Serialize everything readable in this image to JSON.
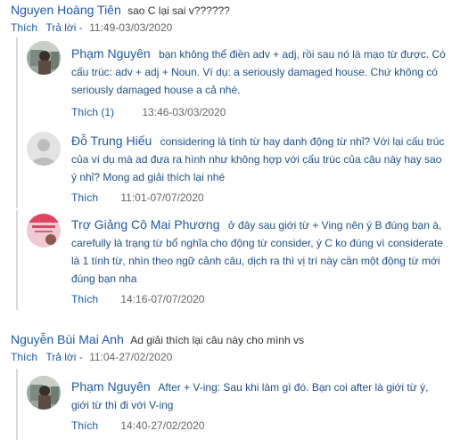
{
  "comments": [
    {
      "author": "Nguyen Hoàng Tiên",
      "text": "sao C lại sai v??????",
      "like": "Thích",
      "reply": "Trả lời -",
      "time": "11:49-03/03/2020",
      "replies": [
        {
          "author": "Phạm Nguyên",
          "text": "bạn không thể điền adv + adj, rồi sau nó là mạo từ được. Có cấu trúc: adv + adj + Noun. Ví dụ: a seriously damaged house. Chứ không có seriously damaged house a cả nhé.",
          "like": "Thích (1)",
          "time": "13:46-03/03/2020"
        },
        {
          "author": "Đỗ Trung Hiếu",
          "text": "considering là tính từ hay danh động từ nhỉ? Với lại cấu trúc của ví dụ mà ad đưa ra hình như không hợp với cấu trúc của câu này hay sao ý nhỉ? Mong ad giải thích lại nhé",
          "like": "Thích",
          "time": "11:01-07/07/2020"
        },
        {
          "author": "Trợ Giảng Cô Mai Phương",
          "text": "ở đây sau giới từ + Ving nên ý B đúng bạn à, carefully là trạng từ bổ nghĩa cho động từ consider, ý C ko đúng vì considerate là 1 tính từ, nhìn theo ngữ cảnh câu, dịch ra thì vị trí này cần một động từ mới đúng bạn nha",
          "like": "Thích",
          "time": "14:16-07/07/2020"
        }
      ]
    },
    {
      "author": "Nguyễn Bùi Mai Anh",
      "text": "Ad giải thích lại câu này cho mình vs",
      "like": "Thích",
      "reply": "Trả lời -",
      "time": "11:04-27/02/2020",
      "replies": [
        {
          "author": "Phạm Nguyên",
          "text": "After + V-ing: Sau khi làm gì đó. Bạn coi after là giới từ ý, giới từ thì đi với V-ing",
          "like": "Thích",
          "time": "14:40-27/02/2020"
        }
      ]
    }
  ]
}
